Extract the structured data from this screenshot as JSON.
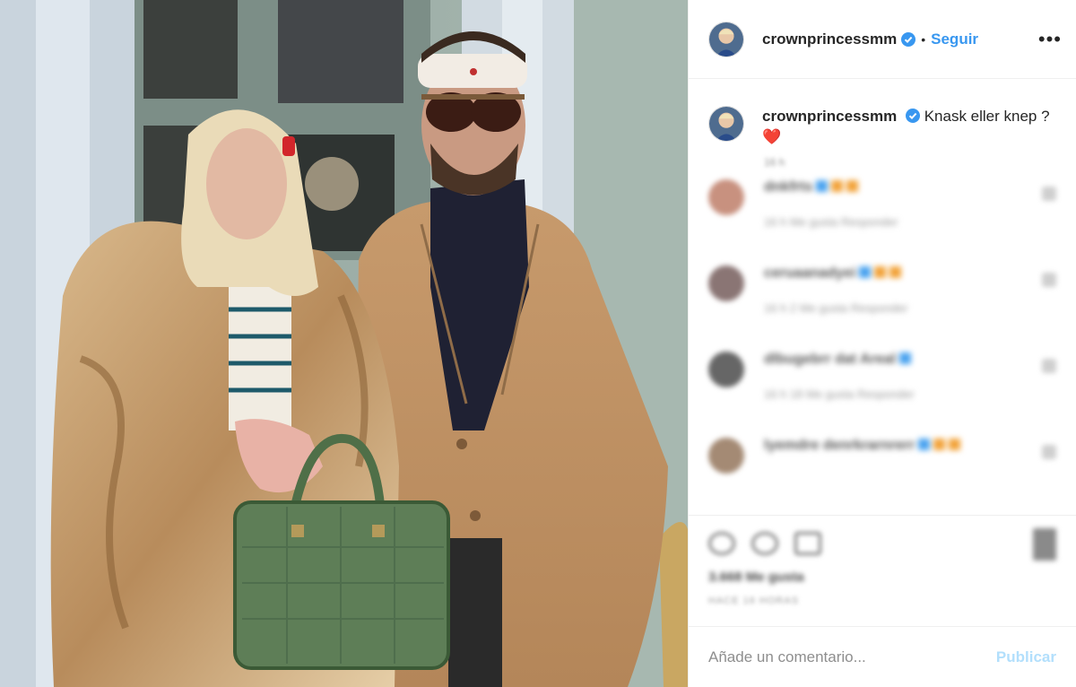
{
  "header": {
    "username": "crownprincessmm",
    "separator": "•",
    "follow_label": "Seguir",
    "more_label": "•••"
  },
  "caption": {
    "username": "crownprincessmm",
    "text": "Knask eller knep ?",
    "emoji": "❤️",
    "time": "16 h"
  },
  "comments": [
    {
      "user": "dnkfrts",
      "line2": "16 h  Me gusta  Responder",
      "avatar_color": "#c8917f",
      "emoji_colors": [
        "#4aa3ef",
        "#f2a33a",
        "#f2a33a"
      ]
    },
    {
      "user": "ceruaanadyei",
      "line2": "16 h  2 Me gusta  Responder",
      "avatar_color": "#8a7574",
      "emoji_colors": [
        "#4aa3ef",
        "#f2a33a",
        "#f2a33a"
      ]
    },
    {
      "user": "dlbugebrr dat Areal",
      "line2": "16 h  18 Me gusta  Responder",
      "avatar_color": "#666666",
      "emoji_colors": [
        "#4aa3ef"
      ]
    },
    {
      "user": "lyemdre denrkrarnrerr",
      "line2": "",
      "avatar_color": "#a48a74",
      "emoji_colors": [
        "#4aa3ef",
        "#f2a33a",
        "#f2a33a"
      ]
    }
  ],
  "actions": {
    "likes": "3.668 Me gusta",
    "date": "HACE 16 HORAS"
  },
  "add_comment": {
    "placeholder": "Añade un comentario...",
    "publish_label": "Publicar"
  },
  "colors": {
    "accent": "#3897f0",
    "verified": "#3897f0",
    "publish_disabled": "#b2dffc"
  }
}
